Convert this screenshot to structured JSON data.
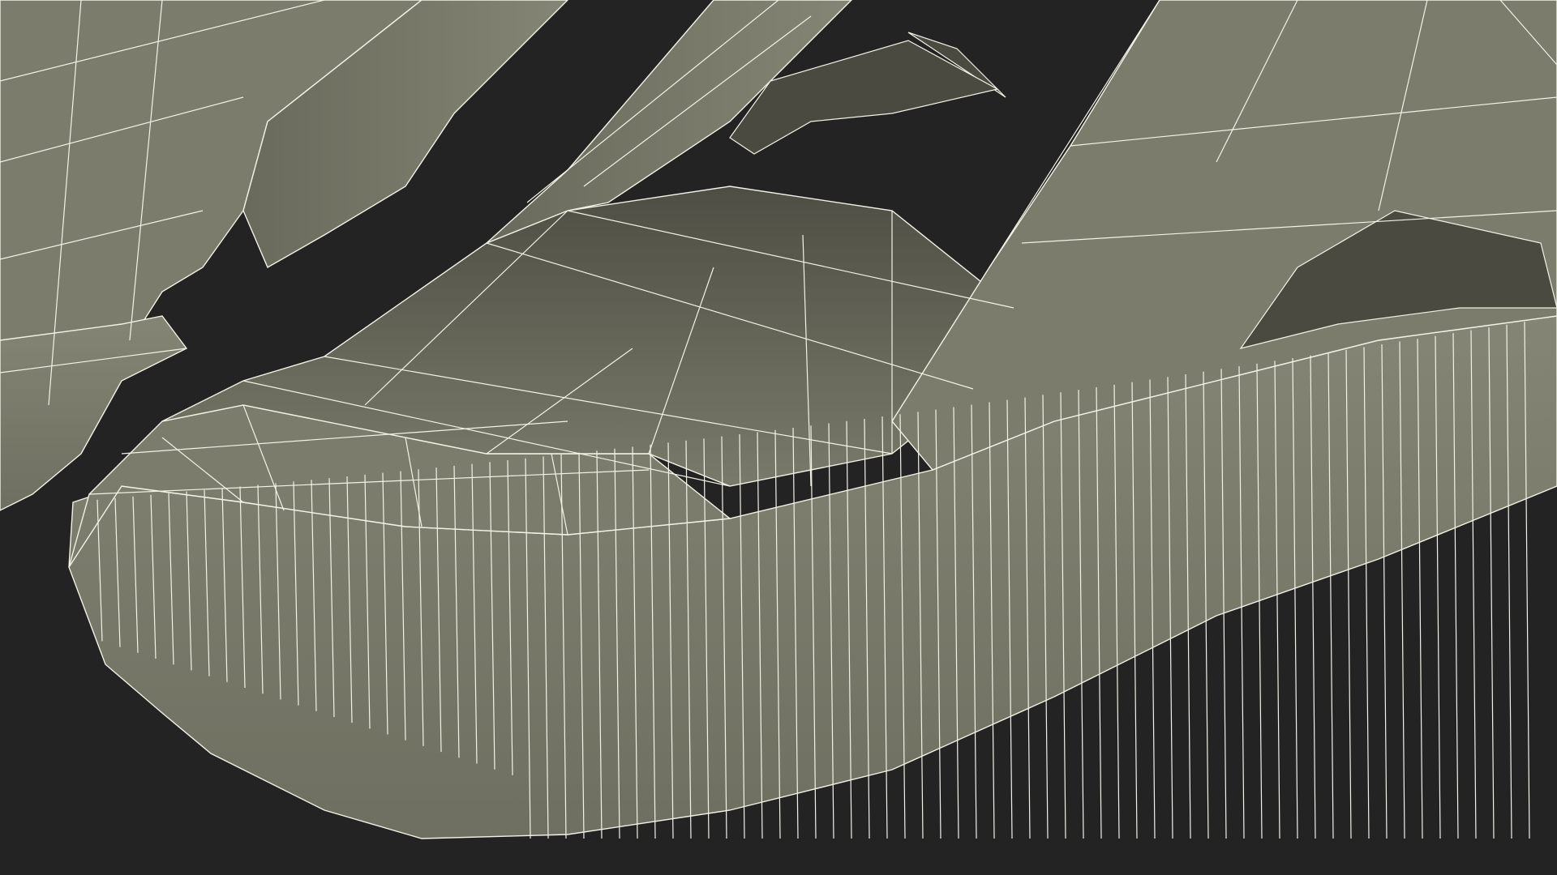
{
  "scene": {
    "background_color": "#232323",
    "surface_color": "#7c7c6d",
    "surface_shadow_color": "#4a4a40",
    "surface_highlight_color": "#8a8a7a",
    "wire_color": "#f2f2e6"
  }
}
